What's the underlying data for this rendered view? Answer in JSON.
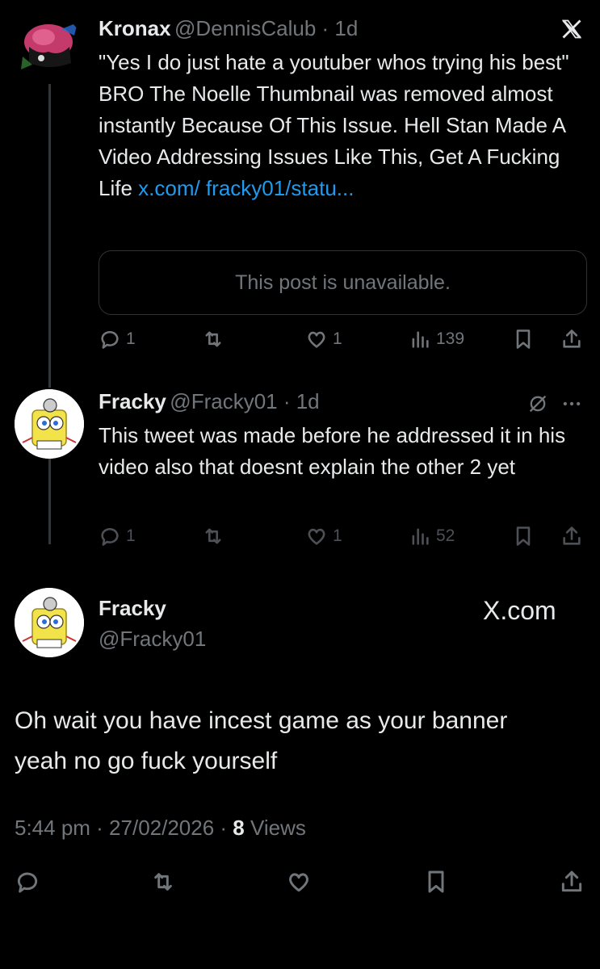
{
  "post1": {
    "display_name": "Kronax",
    "handle_time": "@DennisCalub · 1d",
    "text": "\"Yes I do just hate a youtuber whos trying his best\" BRO The Noelle Thumbnail was removed almost instantly Because Of This Issue. Hell Stan Made A Video Addressing Issues Like This, Get A Fucking Life ",
    "link": "x.com/ fracky01/statu...",
    "quote_unavailable": "This post is unavailable.",
    "replies": "1",
    "likes": "1",
    "views": "139"
  },
  "post2": {
    "display_name": "Fracky",
    "handle_time": "@Fracky01 · 1d",
    "text": "This tweet was made before he addressed it in his video also that doesnt explain the other 2 yet",
    "replies": "1",
    "likes": "1",
    "views": "52"
  },
  "main_post": {
    "display_name": "Fracky",
    "handle": "@Fracky01",
    "watermark": "X.com",
    "text": "Oh wait you have incest game as your banner yeah no go fuck yourself",
    "time": "5:44 pm · 27/02/2026 · ",
    "views_count": "8",
    "views_label": " Views"
  },
  "colors": {
    "background": "#000000",
    "text": "#e7e9ea",
    "muted": "#71767b",
    "link": "#1d9bf0"
  },
  "icons": [
    "x-logo-icon",
    "reply-icon",
    "retweet-icon",
    "like-icon",
    "views-icon",
    "bookmark-icon",
    "share-icon",
    "grok-icon",
    "more-icon"
  ]
}
